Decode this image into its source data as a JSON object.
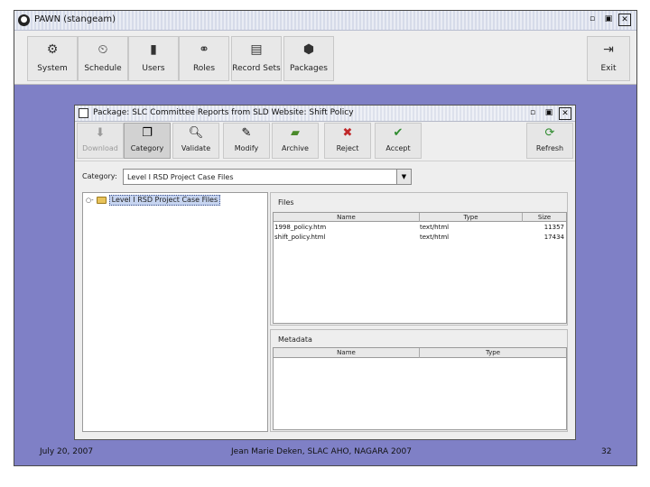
{
  "outer_window": {
    "title": "PAWN (stangeam)",
    "toolbar": [
      {
        "label": "System",
        "icon": "system-icon"
      },
      {
        "label": "Schedule",
        "icon": "schedule-icon"
      },
      {
        "label": "Users",
        "icon": "users-icon"
      },
      {
        "label": "Roles",
        "icon": "roles-icon"
      },
      {
        "label": "Record Sets",
        "icon": "record-sets-icon"
      },
      {
        "label": "Packages",
        "icon": "packages-icon"
      }
    ],
    "exit_label": "Exit"
  },
  "inner_window": {
    "title": "Package: SLC Committee Reports from SLD Website: Shift Policy",
    "toolbar": [
      {
        "label": "Download",
        "icon": "download-icon",
        "disabled": true
      },
      {
        "label": "Category",
        "icon": "category-icon",
        "pressed": true
      },
      {
        "label": "Validate",
        "icon": "validate-icon"
      },
      {
        "label": "Modify",
        "icon": "modify-icon"
      },
      {
        "label": "Archive",
        "icon": "archive-icon"
      },
      {
        "label": "Reject",
        "icon": "reject-icon"
      },
      {
        "label": "Accept",
        "icon": "accept-icon"
      }
    ],
    "refresh_label": "Refresh",
    "category_label": "Category:",
    "category_value": "Level I RSD Project Case Files",
    "tree": {
      "node_label": "Level I RSD Project Case Files"
    },
    "files": {
      "title": "Files",
      "columns": [
        "Name",
        "Type",
        "Size"
      ],
      "rows": [
        {
          "name": "1998_policy.htm",
          "type": "text/html",
          "size": "11357"
        },
        {
          "name": "shift_policy.html",
          "type": "text/html",
          "size": "17434"
        }
      ]
    },
    "metadata": {
      "title": "Metadata",
      "columns": [
        "Name",
        "Type"
      ]
    }
  },
  "footer": {
    "date": "July 20, 2007",
    "credit": "Jean Marie Deken, SLAC AHO, NAGARA 2007",
    "page": "32"
  },
  "colors": {
    "desktop": "#7f80c6",
    "accept_green": "#2e8b2e",
    "reject_red": "#c0282a"
  }
}
